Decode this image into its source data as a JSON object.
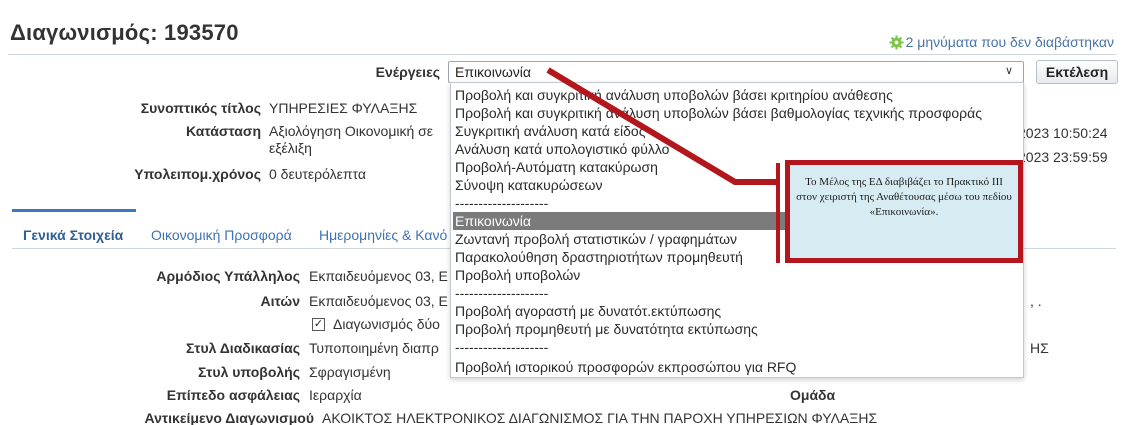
{
  "header": {
    "title": "Διαγωνισμός: 193570",
    "unread_messages": "2 μηνύματα που δεν διαβάστηκαν"
  },
  "actions": {
    "label": "Ενέργειες",
    "selected": "Επικοινωνία",
    "execute_label": "Εκτέλεση",
    "options": [
      "Προβολή και συγκριτική ανάλυση υποβολών βάσει κριτηρίου ανάθεσης",
      "Προβολή και συγκριτική ανάλυση υποβολών βάσει βαθμολογίας τεχνικής προσφοράς",
      "Συγκριτική ανάλυση κατά είδος",
      "Ανάλυση κατά υπολογιστικό φύλλο",
      "Προβολή-Αυτόματη κατακύρωση",
      "Σύνοψη κατακυρώσεων",
      "--------------------",
      "Επικοινωνία",
      "Ζωντανή προβολή στατιστικών / γραφημάτων",
      "Παρακολούθηση δραστηριοτήτων προμηθευτή",
      "Προβολή υποβολών",
      "--------------------",
      "Προβολή αγοραστή με δυνατότ.εκτύπωσης",
      "Προβολή προμηθευτή με δυνατότητα εκτύπωσης",
      "--------------------",
      "Προβολή ιστορικού προσφορών εκπροσώπου για RFQ"
    ],
    "selected_index": 7
  },
  "summary": {
    "short_title_label": "Συνοπτικός τίτλος",
    "short_title_value": "ΥΠΗΡΕΣΙΕΣ ΦΥΛΑΞΗΣ",
    "status_label": "Κατάσταση",
    "status_value_line1": "Αξιολόγηση Οικονομική σε",
    "status_value_line2": "εξέλιξη",
    "remaining_label": "Υπολειπομ.χρόνος",
    "remaining_value": "0 δευτερόλεπτα",
    "date1_partial": "2023 10:50:24",
    "date2_partial": "2023 23:59:59"
  },
  "tabs": [
    {
      "label": "Γενικά Στοιχεία",
      "active": true
    },
    {
      "label": "Οικονομική Προσφορά",
      "active": false
    },
    {
      "label": "Ημερομηνίες & Κανό",
      "active": false
    }
  ],
  "general": {
    "officer_label": "Αρμόδιος Υπάλληλος",
    "officer_value": "Εκπαιδευόμενος 03, Ε",
    "requester_label": "Αιτών",
    "requester_value": "Εκπαιδευόμενος 03, Ε",
    "checkbox_label": "Διαγωνισμός δύο",
    "checkbox_checked": true,
    "procedure_label": "Στυλ Διαδικασίας",
    "procedure_value": "Τυποποιημένη διαπρ",
    "submission_label": "Στυλ υποβολής",
    "submission_value": "Σφραγισμένη",
    "security_label": "Επίπεδο ασφάλειας",
    "security_value": "Ιεραρχία",
    "group_label": "Ομάδα",
    "subject_label": "Αντικείμενο Διαγωνισμού",
    "subject_value": "ΑΚΟΙΚΤΟΣ ΗΛΕΚΤΡΟΝΙΚΟΣ ΔΙΑΓΩΝΙΣΜΟΣ ΓΙΑ ΤΗΝ ΠΑΡΟΧΗ ΥΠΗΡΕΣΙΩΝ ΦΥΛΑΞΗΣ",
    "right_fragment_1": ", .",
    "right_fragment_2": "ΗΣ"
  },
  "annotation": {
    "text": "Το Μέλος της ΕΔ διαβιβάζει το Πρακτικό ΙΙΙ στον χειριστή της Αναθέτουσας μέσω του πεδίου «Επικοινωνία».",
    "color": "#b3161c",
    "fill": "#d6ecf2"
  }
}
